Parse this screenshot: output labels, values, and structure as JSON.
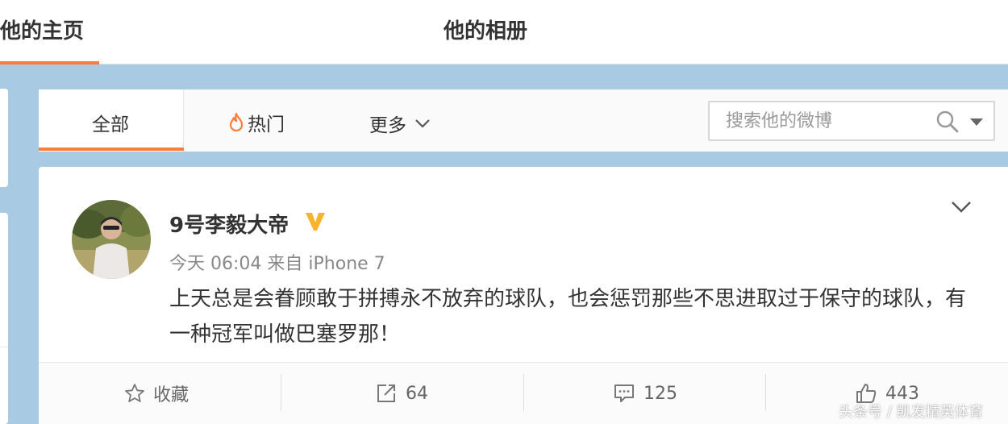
{
  "top_tabs": {
    "home": "他的主页",
    "album": "他的相册"
  },
  "filter": {
    "all": "全部",
    "hot": "热门",
    "more": "更多",
    "search_placeholder": "搜索他的微博"
  },
  "post": {
    "user_name": "9号李毅大帝",
    "time": "今天 06:04",
    "source_prefix": "来自",
    "source": "iPhone 7",
    "text": "上天总是会眷顾敢于拼搏永不放弃的球队，也会惩罚那些不思进取过于保守的球队，有一种冠军叫做巴塞罗那！",
    "actions": {
      "favorite": "收藏",
      "forward": "64",
      "comment": "125",
      "like": "443"
    }
  },
  "watermark": "头条号 / 凯发精英体育",
  "colors": {
    "accent": "#fa7d3c",
    "vip_badge": "#f7b32b",
    "background": "#a8cbe3"
  },
  "icons": [
    "fire-icon",
    "chevron-down-icon",
    "search-icon",
    "caret-down-icon",
    "vip-verified-icon",
    "star-icon",
    "forward-icon",
    "comment-icon",
    "like-icon"
  ]
}
